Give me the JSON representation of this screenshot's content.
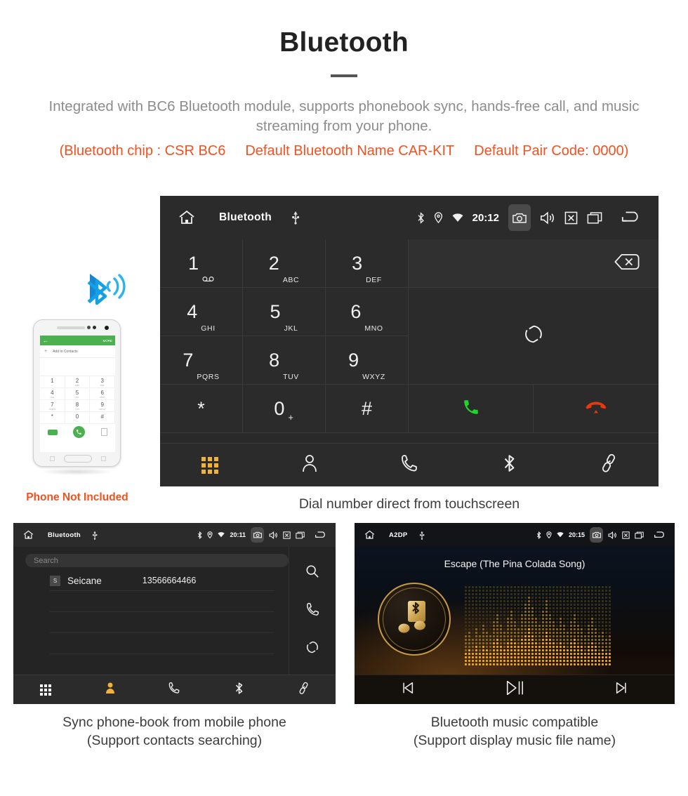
{
  "header": {
    "title": "Bluetooth",
    "subtitle": "Integrated with BC6 Bluetooth module, supports phonebook sync, hands-free call, and music streaming from your phone.",
    "spec_chip": "(Bluetooth chip : CSR BC6",
    "spec_name": "Default Bluetooth Name CAR-KIT",
    "spec_pair": "Default Pair Code: 0000)",
    "accent_color": "#f4511e",
    "text_color": "#8c8c8c"
  },
  "phone_mock": {
    "not_included_label": "Phone Not Included",
    "screen": {
      "more_label": "MORE",
      "add_contact_label": "Add to Contacts",
      "keys": [
        {
          "digit": "1",
          "letters": ""
        },
        {
          "digit": "2",
          "letters": "ABC"
        },
        {
          "digit": "3",
          "letters": "DEF"
        },
        {
          "digit": "4",
          "letters": "GHI"
        },
        {
          "digit": "5",
          "letters": "JKL"
        },
        {
          "digit": "6",
          "letters": "MNO"
        },
        {
          "digit": "7",
          "letters": "PQRS"
        },
        {
          "digit": "8",
          "letters": "TUV"
        },
        {
          "digit": "9",
          "letters": "WXYZ"
        },
        {
          "digit": "*",
          "letters": ""
        },
        {
          "digit": "0",
          "letters": "+"
        },
        {
          "digit": "#",
          "letters": ""
        }
      ]
    }
  },
  "dialer": {
    "sysbar": {
      "title": "Bluetooth",
      "clock": "20:12",
      "icons": [
        "home-icon",
        "usb-icon",
        "bluetooth-icon",
        "location-icon",
        "wifi-icon",
        "camera-icon",
        "volume-icon",
        "close-box-icon",
        "recent-apps-icon",
        "back-icon"
      ]
    },
    "keys": [
      {
        "digit": "1",
        "letters": ""
      },
      {
        "digit": "2",
        "letters": "ABC"
      },
      {
        "digit": "3",
        "letters": "DEF"
      },
      {
        "digit": "4",
        "letters": "GHI"
      },
      {
        "digit": "5",
        "letters": "JKL"
      },
      {
        "digit": "6",
        "letters": "MNO"
      },
      {
        "digit": "7",
        "letters": "PQRS"
      },
      {
        "digit": "8",
        "letters": "TUV"
      },
      {
        "digit": "9",
        "letters": "WXYZ"
      },
      {
        "digit": "*",
        "letters": ""
      },
      {
        "digit": "0",
        "letters": "+"
      },
      {
        "digit": "#",
        "letters": ""
      }
    ],
    "actions": {
      "backspace": "backspace-icon",
      "sync": "sync-icon",
      "call": "call-icon",
      "hangup": "hangup-icon",
      "call_color": "#22d629",
      "hangup_color": "#e8380d"
    },
    "nav": [
      {
        "name": "keypad",
        "icon": "keypad-icon",
        "active": true
      },
      {
        "name": "contacts",
        "icon": "person-icon",
        "active": false
      },
      {
        "name": "call-log",
        "icon": "phone-icon",
        "active": false
      },
      {
        "name": "bluetooth",
        "icon": "bluetooth-icon",
        "active": false
      },
      {
        "name": "link",
        "icon": "link-icon",
        "active": false
      }
    ],
    "nav_active_color": "#f2b138",
    "caption": "Dial number direct from touchscreen"
  },
  "contacts": {
    "sysbar": {
      "title": "Bluetooth",
      "clock": "20:11"
    },
    "search_placeholder": "Search",
    "rows": [
      {
        "badge": "S",
        "name": "Seicane",
        "number": "13566664466"
      }
    ],
    "side_icons": [
      "search-icon",
      "phone-icon",
      "sync-icon"
    ],
    "nav": [
      {
        "name": "keypad",
        "icon": "keypad-icon",
        "active": false
      },
      {
        "name": "contacts",
        "icon": "person-icon",
        "active": true
      },
      {
        "name": "call-log",
        "icon": "phone-icon",
        "active": false
      },
      {
        "name": "bluetooth",
        "icon": "bluetooth-icon",
        "active": false
      },
      {
        "name": "link",
        "icon": "link-icon",
        "active": false
      }
    ],
    "caption_line1": "Sync phone-book from mobile phone",
    "caption_line2": "(Support contacts searching)"
  },
  "music": {
    "sysbar": {
      "title": "A2DP",
      "clock": "20:15"
    },
    "song_title": "Escape (The Pina Colada Song)",
    "album_art_icon": "music-note-bluetooth-icon",
    "accent_color": "#c89b45",
    "transport": [
      {
        "name": "previous",
        "icon": "skip-previous-icon"
      },
      {
        "name": "play-pause",
        "icon": "play-pause-icon"
      },
      {
        "name": "next",
        "icon": "skip-next-icon"
      }
    ],
    "caption_line1": "Bluetooth music compatible",
    "caption_line2": "(Support display music file name)"
  }
}
